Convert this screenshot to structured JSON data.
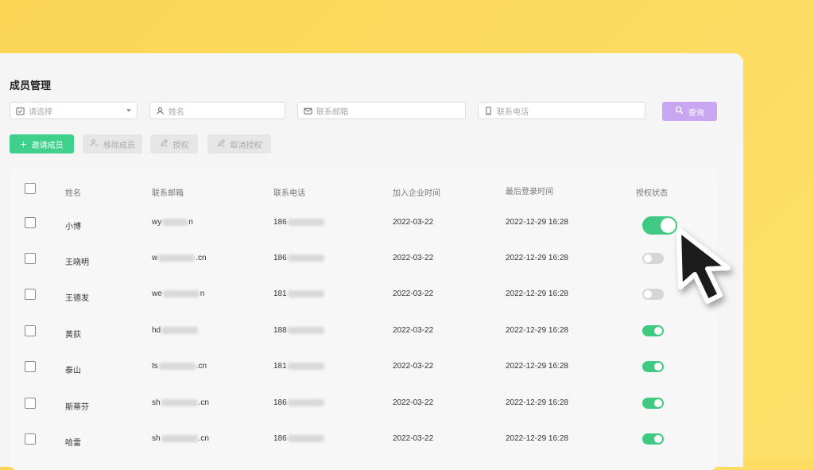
{
  "page": {
    "title": "成员管理"
  },
  "filters": {
    "select_placeholder": "请选择",
    "name_placeholder": "姓名",
    "email_placeholder": "联系邮箱",
    "phone_placeholder": "联系电话",
    "query_label": "查询"
  },
  "actions": {
    "invite_label": "邀请成员",
    "remove_label": "移除成员",
    "authorize_label": "授权",
    "revoke_label": "取消授权"
  },
  "table": {
    "columns": [
      "姓名",
      "联系邮箱",
      "联系电话",
      "加入企业时间",
      "最后登录时间",
      "授权状态"
    ],
    "rows": [
      {
        "name": "小博",
        "email_prefix": "wy",
        "email_suffix": "n",
        "phone_prefix": "186",
        "joined": "2022-03-22",
        "last_login": "2022-12-29 16:28",
        "authorized": true
      },
      {
        "name": "王晓明",
        "email_prefix": "w",
        "email_suffix": ".cn",
        "phone_prefix": "186",
        "joined": "2022-03-22",
        "last_login": "2022-12-29 16:28",
        "authorized": false
      },
      {
        "name": "王德发",
        "email_prefix": "we",
        "email_suffix": "n",
        "phone_prefix": "181",
        "joined": "2022-03-22",
        "last_login": "2022-12-29 16:28",
        "authorized": false
      },
      {
        "name": "黄荻",
        "email_prefix": "hd",
        "email_suffix": "",
        "phone_prefix": "188",
        "joined": "2022-03-22",
        "last_login": "2022-12-29 16:28",
        "authorized": true
      },
      {
        "name": "泰山",
        "email_prefix": "ts",
        "email_suffix": ".cn",
        "phone_prefix": "181",
        "joined": "2022-03-22",
        "last_login": "2022-12-29 16:28",
        "authorized": true
      },
      {
        "name": "斯蒂芬",
        "email_prefix": "sh",
        "email_suffix": ".cn",
        "phone_prefix": "186",
        "joined": "2022-03-22",
        "last_login": "2022-12-29 16:28",
        "authorized": true
      },
      {
        "name": "哈雷",
        "email_prefix": "sh",
        "email_suffix": ".cn",
        "phone_prefix": "186",
        "joined": "2022-03-22",
        "last_login": "2022-12-29 16:28",
        "authorized": true
      }
    ]
  },
  "colors": {
    "background": "#fcd555",
    "primary_green": "#3fd08c",
    "query_purple": "#c9a6f2",
    "toggle_on": "#3fc983",
    "toggle_off": "#d6d6d6"
  },
  "icons": [
    "calendar-icon",
    "user-icon",
    "mail-icon",
    "phone-icon",
    "search-icon",
    "plus-icon",
    "remove-user-icon",
    "pen-icon",
    "cursor-icon"
  ]
}
